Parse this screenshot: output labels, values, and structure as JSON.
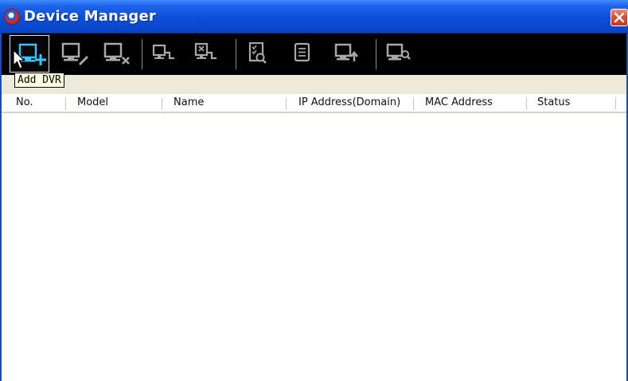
{
  "window": {
    "title": "Device Manager"
  },
  "toolbar": {
    "buttons": [
      {
        "name": "add-dvr-button",
        "icon": "monitor-plus-icon"
      },
      {
        "name": "edit-dvr-button",
        "icon": "monitor-pencil-icon"
      },
      {
        "name": "delete-dvr-button",
        "icon": "monitor-x-icon"
      },
      {
        "name": "connect-button",
        "icon": "monitor-connect-icon"
      },
      {
        "name": "disconnect-button",
        "icon": "monitor-disconnect-icon"
      },
      {
        "name": "check-list-button",
        "icon": "checklist-search-icon"
      },
      {
        "name": "log-button",
        "icon": "document-icon"
      },
      {
        "name": "upgrade-button",
        "icon": "monitor-arrow-icon"
      },
      {
        "name": "search-dvr-button",
        "icon": "monitor-search-icon"
      }
    ],
    "tooltip": "Add DVR"
  },
  "table": {
    "columns": [
      "No.",
      "Model",
      "Name",
      "IP Address(Domain)",
      "MAC Address",
      "Status"
    ],
    "rows": []
  }
}
